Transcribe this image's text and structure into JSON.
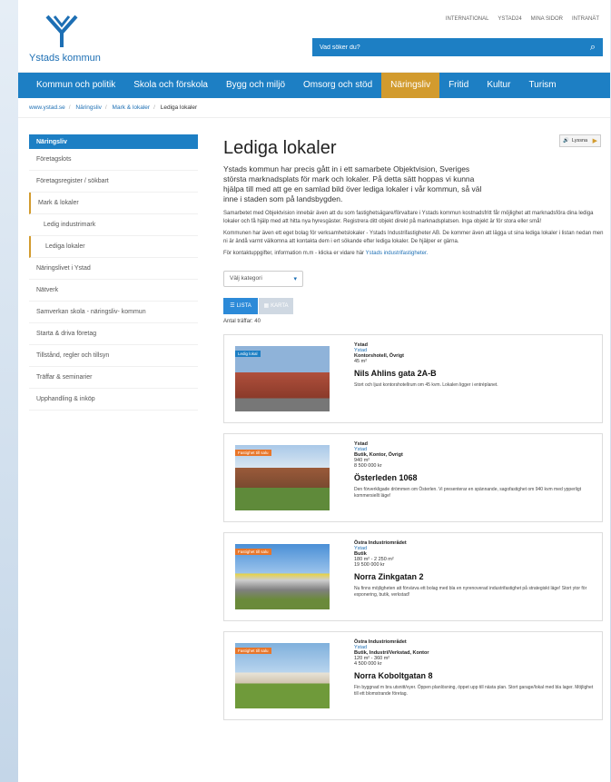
{
  "header": {
    "logo_text": "Ystads kommun",
    "top_links": [
      "INTERNATIONAL",
      "YSTAD24",
      "MINA SIDOR",
      "INTRANÄT"
    ],
    "search_placeholder": "Vad söker du?"
  },
  "nav": {
    "items": [
      "Kommun och politik",
      "Skola och förskola",
      "Bygg och miljö",
      "Omsorg och stöd",
      "Näringsliv",
      "Fritid",
      "Kultur",
      "Turism"
    ],
    "active": "Näringsliv"
  },
  "breadcrumb": [
    "www.ystad.se",
    "Näringsliv",
    "Mark & lokaler",
    "Lediga lokaler"
  ],
  "sidebar": {
    "header": "Näringsliv",
    "items": [
      "Företagslots",
      "Företagsregister / sökbart",
      "Mark & lokaler",
      "Ledig industrimark",
      "Lediga lokaler",
      "Näringslivet i Ystad",
      "Nätverk",
      "Samverkan skola - näringsliv- kommun",
      "Starta & driva företag",
      "Tillstånd, regler och tillsyn",
      "Träffar & seminarier",
      "Upphandling & inköp"
    ]
  },
  "main": {
    "share_label": "Lyssna",
    "title": "Lediga lokaler",
    "lead": "Ystads kommun har precis gått in i ett samarbete Objektvision, Sveriges största marknadsplats för mark och lokaler. På detta sätt hoppas vi kunna hjälpa till med att ge en samlad bild över lediga lokaler i vår kommun, så väl inne i staden som på landsbygden.",
    "para1": "Samarbetet med Objektvision innebär även att du som fastighetsägare/förvaltare i Ystads kommun kostnadsfritt får möjlighet att marknadsföra dina lediga lokaler och få hjälp med att hitta nya hyresgäster. Registrera ditt objekt direkt på marknadsplatsen. Inga objekt är för stora eller små!",
    "para2": "Kommunen har även ett eget bolag för verksamhetslokaler - Ystads Industrifastigheter AB. De kommer även att lägga ut sina lediga lokaler i listan nedan men ni är ändå varmt välkomna att kontakta dem i ert sökande efter lediga lokaler. De hjälper er gärna.",
    "para3": "För kontaktuppgifter, information m.m - klicka er vidare här",
    "para3_link": "Ystads industrifastigheter.",
    "category_select": "Välj kategori",
    "view_list": "LISTA",
    "view_map": "KARTA",
    "count": "Antal träffar: 40"
  },
  "listings": [
    {
      "tag": "Ledig lokal",
      "area": "Ystad",
      "city": "Ystad",
      "kind": "Kontorshotell, Övrigt",
      "size": "45 m²",
      "price": "",
      "address": "Nils Ahlins gata 2A-B",
      "description": "Stort och ljust kontorshotellrum om 45 kvm. Lokalen ligger i entréplanet."
    },
    {
      "tag": "Fastighet till salu",
      "area": "Ystad",
      "city": "Ystad",
      "kind": "Butik, Kontor, Övrigt",
      "size": "940 m²",
      "price": "8 500 000 kr",
      "address": "Österleden 1068",
      "description": "Den förverkligade drömmen om Österlen. Vi presenterar en spännande, sagofastighet om 940 kvm med ypperligt kommersiellt läge!"
    },
    {
      "tag": "Fastighet till salu",
      "area": "Östra Industriområdet",
      "city": "Ystad",
      "kind": "Butik",
      "size": "180 m² - 2 250 m²",
      "price": "19 500 000 kr",
      "address": "Norra Zinkgatan 2",
      "description": "Nu finns möjligheten att förvärva ett bolag med bla en nyrenoverad industrifastighet på strategiskt läge! Stort ytor för exponering, butik, verkstad!"
    },
    {
      "tag": "Fastighet till salu",
      "area": "Östra Industriområdet",
      "city": "Ystad",
      "kind": "Butik, Industri/Verkstad, Kontor",
      "size": "120 m² - 360 m²",
      "price": "4 500 000 kr",
      "address": "Norra Koboltgatan 8",
      "description": "Fin byggnad m bra utsnitt/vyer. Öppen planlösning, öppet upp till nästa plan. Stort garage/lokal med bla lager. Möjlighet till ett blomstrande företag."
    }
  ],
  "colors": {
    "brand_blue": "#1d7fc4",
    "accent_gold": "#d29b2e",
    "tag_orange": "#e8762a",
    "tag_blue": "#1d7fc4"
  }
}
